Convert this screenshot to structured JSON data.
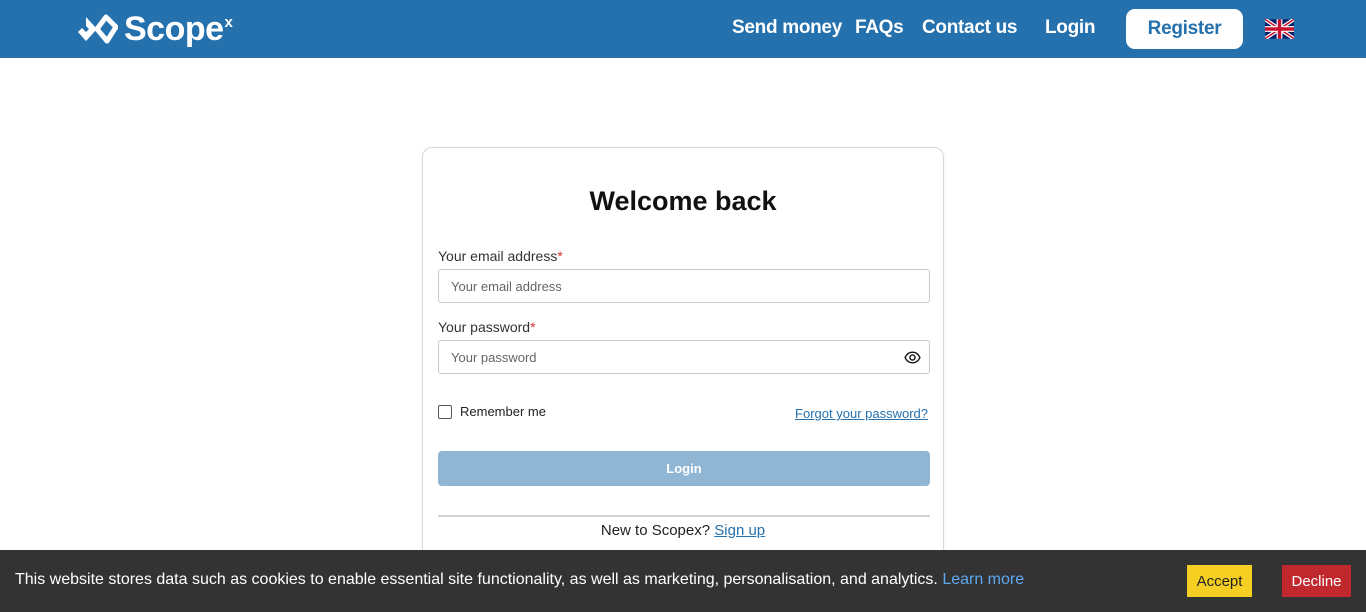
{
  "header": {
    "logo_text": "Scope",
    "logo_suffix": "x",
    "nav": {
      "send_money": "Send money",
      "faqs": "FAQs",
      "contact": "Contact us",
      "login": "Login"
    },
    "register_label": "Register",
    "language_icon": "uk-flag-icon",
    "bg_color": "#2571ad"
  },
  "login_card": {
    "title": "Welcome back",
    "email_label": "Your email address",
    "email_placeholder": "Your email address",
    "email_value": "",
    "password_label": "Your password",
    "password_placeholder": "Your password",
    "password_value": "",
    "required_marker": "*",
    "remember_label": "Remember me",
    "remember_checked": false,
    "forgot_label": "Forgot your password?",
    "login_button": "Login",
    "signup_prompt": "New to Scopex?",
    "signup_link": "Sign up",
    "password_toggle_icon": "eye-icon"
  },
  "cookie_bar": {
    "message": "This website stores data such as cookies to enable essential site functionality, as well as marketing, personalisation, and analytics.",
    "learn_more": "Learn more",
    "accept": "Accept",
    "decline": "Decline",
    "accept_color": "#f5d022",
    "decline_color": "#c0282d"
  }
}
